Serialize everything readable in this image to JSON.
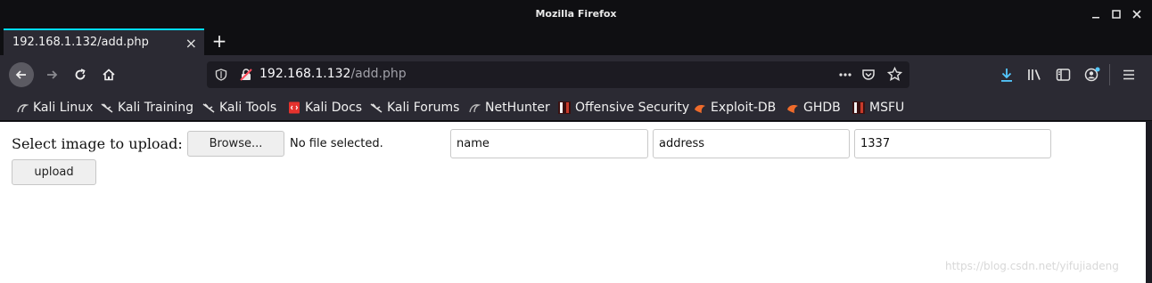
{
  "window": {
    "title": "Mozilla Firefox",
    "controls": [
      "minimize-icon",
      "maximize-icon",
      "close-icon"
    ]
  },
  "tab": {
    "title": "192.168.1.132/add.php",
    "close_glyph": "×",
    "new_tab_glyph": "+"
  },
  "address": {
    "host": "192.168.1.132",
    "path": "/add.php"
  },
  "bookmarks": [
    {
      "label": "Kali Linux",
      "icon": "kali-dragon-icon"
    },
    {
      "label": "Kali Training",
      "icon": "kali-dragon-icon"
    },
    {
      "label": "Kali Tools",
      "icon": "kali-dragon-icon"
    },
    {
      "label": "Kali Docs",
      "icon": "kali-docs-icon"
    },
    {
      "label": "Kali Forums",
      "icon": "kali-dragon-icon"
    },
    {
      "label": "NetHunter",
      "icon": "nethunter-icon"
    },
    {
      "label": "Offensive Security",
      "icon": "offsec-icon"
    },
    {
      "label": "Exploit-DB",
      "icon": "exploitdb-icon"
    },
    {
      "label": "GHDB",
      "icon": "exploitdb-icon"
    },
    {
      "label": "MSFU",
      "icon": "offsec-icon"
    }
  ],
  "form": {
    "label": "Select image to upload:",
    "browse_label": "Browse...",
    "file_status": "No file selected.",
    "fields": [
      {
        "name": "name",
        "value": "name"
      },
      {
        "name": "address",
        "value": "address"
      },
      {
        "name": "number",
        "value": "1337"
      }
    ],
    "upload_label": "upload"
  },
  "watermark": "https://blog.csdn.net/yifujiadeng",
  "colors": {
    "accent": "#00ddff",
    "download": "#54ffbd"
  }
}
